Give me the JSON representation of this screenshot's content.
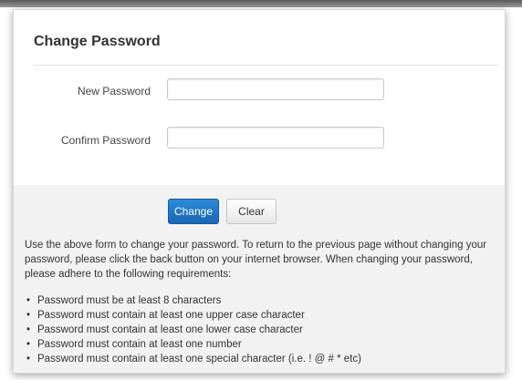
{
  "form": {
    "title": "Change Password",
    "fields": {
      "new_password": {
        "label": "New Password",
        "value": ""
      },
      "confirm_password": {
        "label": "Confirm Password",
        "value": ""
      }
    },
    "buttons": {
      "change": "Change",
      "clear": "Clear"
    }
  },
  "help": {
    "instructions": "Use the above form to change your password. To return to the previous page without changing your password, please click the back button on your internet browser. When changing your password, please adhere to the following requirements:",
    "requirements": [
      "Password must be at least 8 characters",
      "Password must contain at least one upper case character",
      "Password must contain at least one lower case character",
      "Password must contain at least one number",
      "Password must contain at least one special character (i.e. ! @ # * etc)"
    ]
  },
  "colors": {
    "primary_button": "#1f74c4",
    "footer_background": "#f2f2f2"
  }
}
